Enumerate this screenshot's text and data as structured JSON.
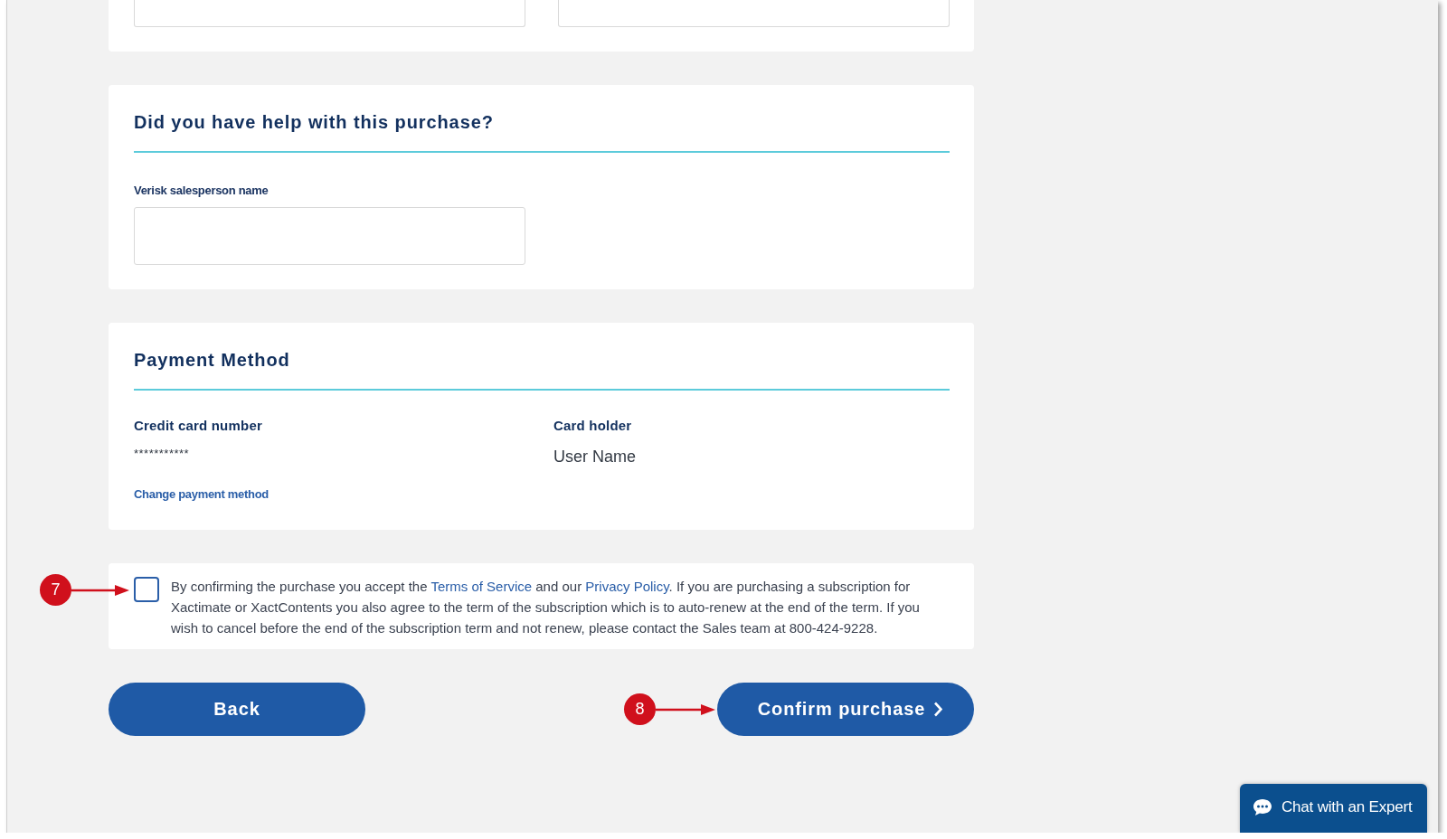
{
  "sales_help": {
    "title": "Did you have help with this purchase?",
    "field": {
      "label": "Verisk salesperson name"
    }
  },
  "payment_method": {
    "title": "Payment Method",
    "details": [
      {
        "kind": "masked",
        "label": "Credit card number",
        "value": "***********"
      },
      {
        "kind": "plain",
        "label": "Card holder",
        "value": "User Name"
      }
    ],
    "change_link": "Change payment method"
  },
  "agreement": {
    "checked": false,
    "callout": "7",
    "parts": [
      {
        "kind": "text",
        "text": "By confirming the purchase you accept the "
      },
      {
        "kind": "link",
        "text": "Terms of Service"
      },
      {
        "kind": "text",
        "text": " and our "
      },
      {
        "kind": "link",
        "text": "Privacy Policy"
      },
      {
        "kind": "text",
        "text": ". If you are purchasing a subscription for Xactimate or XactContents you also agree to the term of the subscription which is to auto-renew at the end of the term. If you wish to cancel before the end of the subscription term and not renew, please contact the Sales team at 800-424-9228."
      }
    ]
  },
  "buttons": [
    {
      "kind": "back",
      "label": "Back"
    },
    {
      "kind": "next",
      "label": "Confirm purchase",
      "callout": "8"
    }
  ],
  "chat_button": {
    "label": "Chat with an Expert"
  }
}
